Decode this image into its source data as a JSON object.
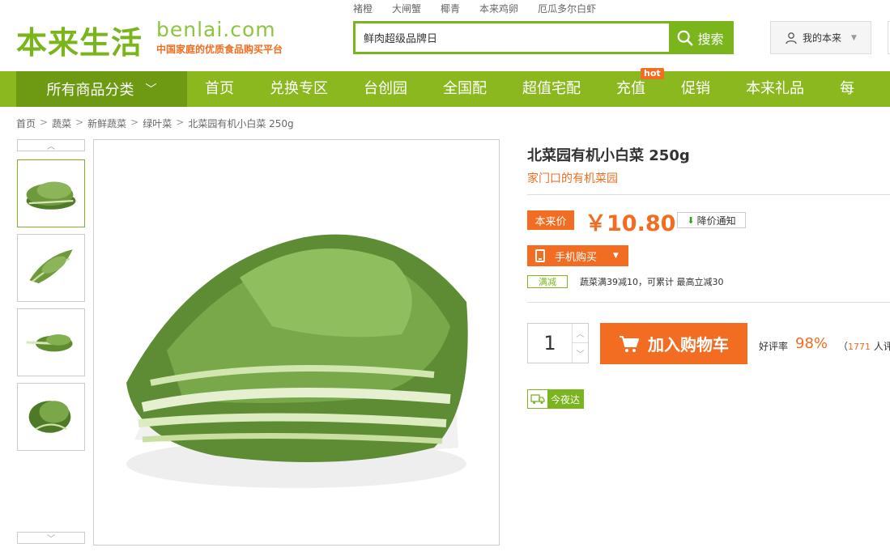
{
  "header": {
    "logo_cn": "本来生活",
    "logo_en": "benlai.com",
    "logo_tagline": "中国家庭的优质食品购买平台",
    "hot_words": [
      "褚橙",
      "大闸蟹",
      "椰青",
      "本来鸡卵",
      "厄瓜多尔白虾"
    ],
    "search": {
      "value": "鲜肉超级品牌日",
      "button_label": "搜索"
    },
    "account_label": "我的本来"
  },
  "nav": {
    "category_label": "所有商品分类",
    "items": [
      "首页",
      "兑换专区",
      "台创园",
      "全国配",
      "超值宅配",
      "充值",
      "促销",
      "本来礼品",
      "每"
    ],
    "hot_badge": "hot"
  },
  "breadcrumb": [
    "首页",
    "蔬菜",
    "新鲜蔬菜",
    "绿叶菜",
    "北菜园有机小白菜 250g"
  ],
  "product": {
    "title": "北菜园有机小白菜 250g",
    "subtitle": "家门口的有机菜园",
    "price_label": "本来价",
    "price": "￥10.80",
    "price_alert": "降价通知",
    "mobile_buy": "手机购买",
    "promo_tag": "满减",
    "promo_text": "蔬菜满39减10，可累计  最高立减30",
    "quantity": "1",
    "add_to_cart": "加入购物车",
    "rating_label": "好评率",
    "rating_value": "98%",
    "rating_count_prefix": "（",
    "rating_count": "1771",
    "rating_count_suffix": " 人评",
    "delivery_label": "今夜达"
  },
  "colors": {
    "brand_green": "#7ab51d",
    "accent_orange": "#f26d21"
  }
}
